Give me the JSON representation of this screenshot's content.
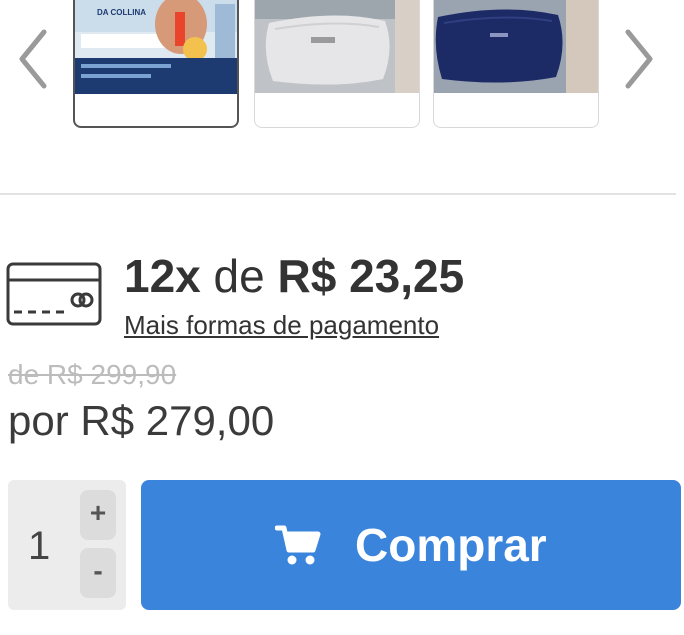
{
  "gallery": {
    "prev_icon": "chevron-left-icon",
    "next_icon": "chevron-right-icon",
    "thumbnails": [
      {
        "label": "DA COLLINA",
        "selected": true
      },
      {
        "selected": false
      },
      {
        "selected": false
      }
    ]
  },
  "payment": {
    "card_icon": "credit-card-icon",
    "installments_prefix": "12x",
    "installments_middle": "de",
    "installments_value": "R$ 23,25",
    "more_options": "Mais formas de pagamento"
  },
  "pricing": {
    "old_price": "de R$ 299,90",
    "new_price": "por R$ 279,00"
  },
  "quantity": {
    "value": "1",
    "increment_label": "+",
    "decrement_label": "-"
  },
  "buy_button": {
    "label": "Comprar",
    "icon": "shopping-cart-icon",
    "color": "#3a84dc"
  }
}
